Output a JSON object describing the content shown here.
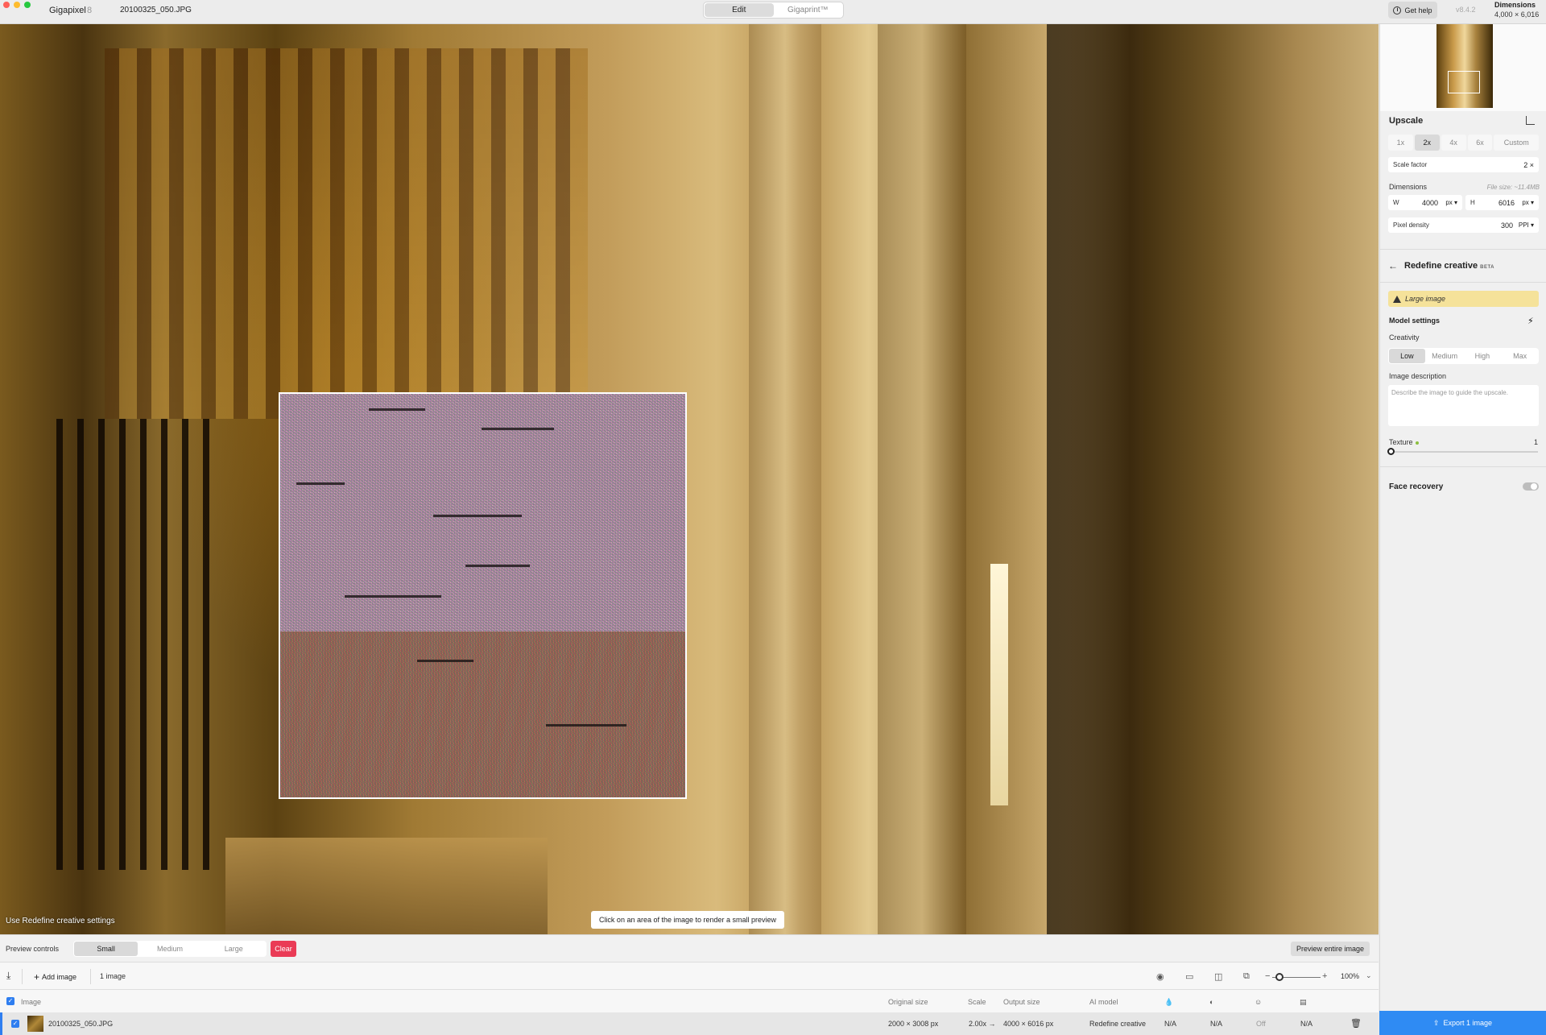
{
  "titlebar": {
    "app_name": "Gigapixel",
    "app_version": "8",
    "file_name": "20100325_050.JPG",
    "modes": [
      "Edit",
      "Gigaprint™"
    ],
    "active_mode": "Edit",
    "help_label": "Get help",
    "version": "v8.4.2",
    "dimensions_label": "Dimensions",
    "dimensions_value": "4,000 × 6,016"
  },
  "canvas": {
    "caption": "Use Redefine creative settings",
    "hint": "Click on an area of the image to render a small preview"
  },
  "upscale": {
    "title": "Upscale",
    "scale_options": [
      "1x",
      "2x",
      "4x",
      "6x",
      "Custom"
    ],
    "active_scale": "2x",
    "scale_factor_label": "Scale factor",
    "scale_factor_value": "2 ×",
    "dimensions_label": "Dimensions",
    "file_size": "File size: ~11.4MB",
    "width_label": "W",
    "width_value": "4000",
    "width_unit": "px ▾",
    "height_label": "H",
    "height_value": "6016",
    "height_unit": "px ▾",
    "pixel_density_label": "Pixel density",
    "pixel_density_value": "300",
    "pixel_density_unit": "PPI ▾"
  },
  "redefine": {
    "title": "Redefine creative",
    "beta": "BETA",
    "warning": "Large image",
    "model_settings": "Model settings",
    "creativity_label": "Creativity",
    "creativity_options": [
      "Low",
      "Medium",
      "High",
      "Max"
    ],
    "active_creativity": "Low",
    "description_label": "Image description",
    "description_placeholder": "Describe the image to guide the upscale.",
    "texture_label": "Texture",
    "texture_value": "1",
    "texture_level": 0,
    "face_recovery_label": "Face recovery",
    "face_recovery_on": false
  },
  "preview_controls": {
    "label": "Preview controls",
    "sizes": [
      "Small",
      "Medium",
      "Large"
    ],
    "active_size": "Small",
    "clear_label": "Clear",
    "preview_entire_label": "Preview entire image"
  },
  "queue": {
    "add_image_label": "Add image",
    "image_count": "1 image",
    "zoom": "100%"
  },
  "table": {
    "headers": {
      "image": "Image",
      "original_size": "Original size",
      "scale": "Scale",
      "output_size": "Output size",
      "ai_model": "AI model"
    },
    "rows": [
      {
        "name": "20100325_050.JPG",
        "original_size": "2000 × 3008 px",
        "scale": "2.00x →",
        "output_size": "4000 × 6016 px",
        "ai_model": "Redefine creative",
        "col1": "N/A",
        "col2": "N/A",
        "col3": "Off",
        "col4": "N/A"
      }
    ]
  },
  "export": {
    "label": "Export 1 image"
  },
  "colors": {
    "accent": "#2f8bf3",
    "clear": "#ea3b56",
    "warning_bg": "#f5e29a"
  }
}
